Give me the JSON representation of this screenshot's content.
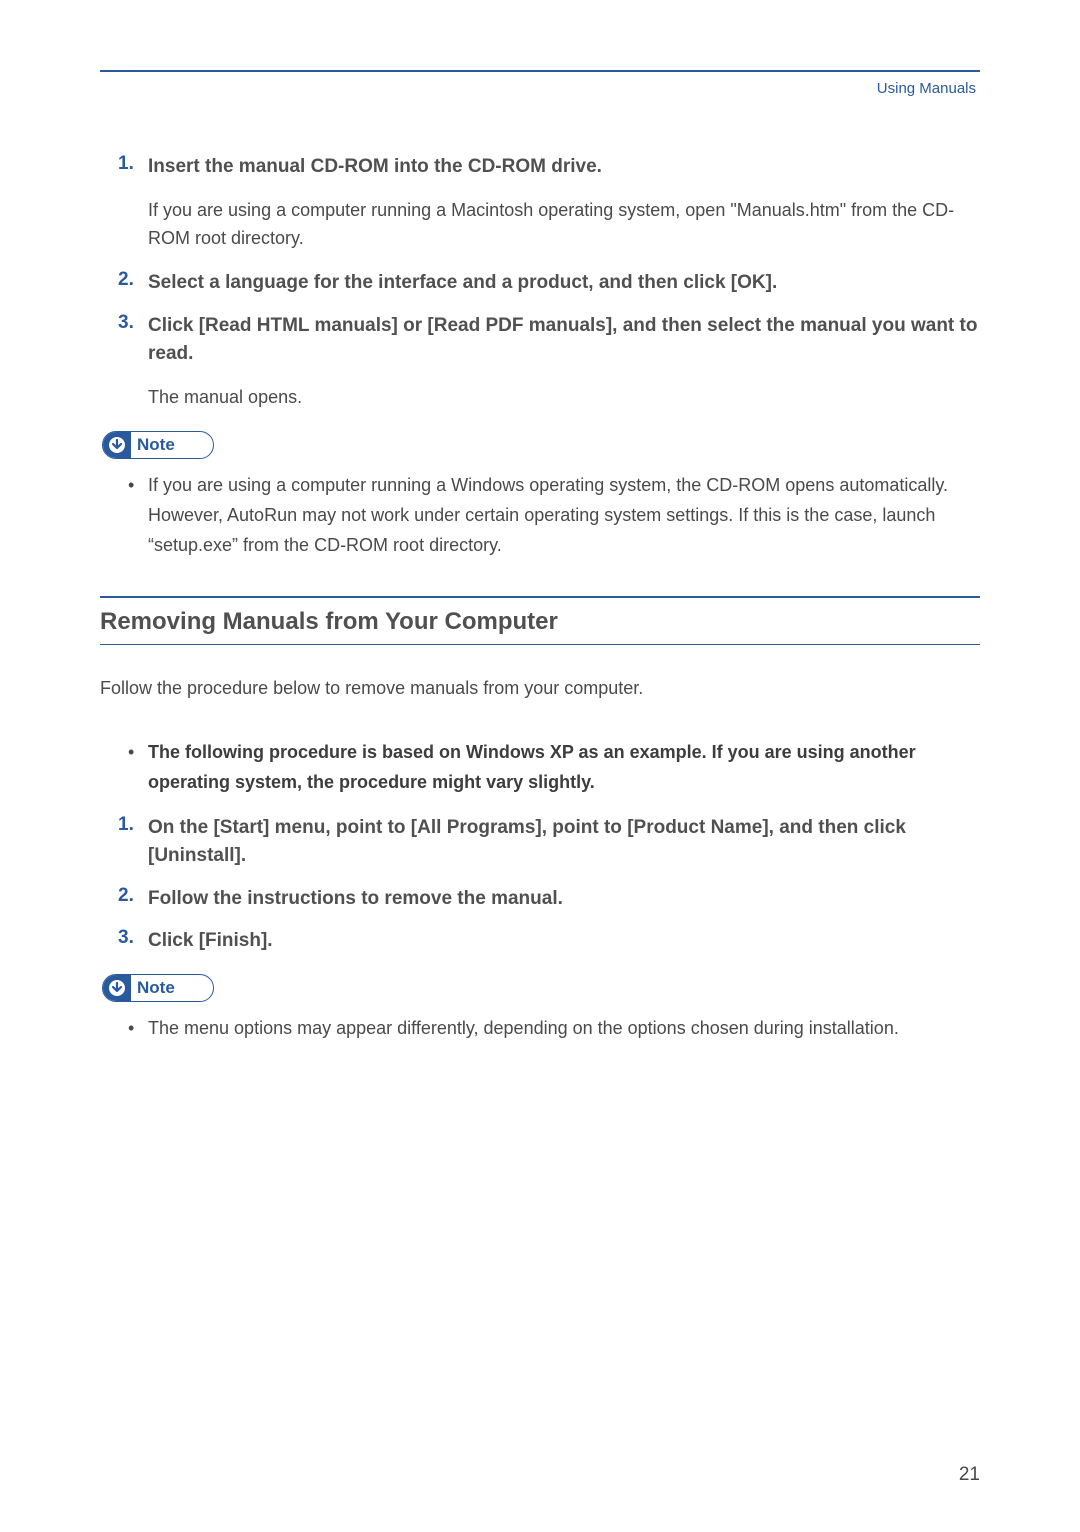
{
  "header": {
    "breadcrumb": "Using Manuals"
  },
  "steps_a": [
    {
      "num": "1.",
      "text": "Insert the manual CD-ROM into the CD-ROM drive.",
      "sub": "If you are using a computer running a Macintosh operating system, open \"Manuals.htm\" from the CD-ROM root directory."
    },
    {
      "num": "2.",
      "text": "Select a language for the interface and a product, and then click [OK]."
    },
    {
      "num": "3.",
      "text": "Click [Read HTML manuals] or [Read PDF manuals], and then select the manual you want to read.",
      "sub": "The manual opens."
    }
  ],
  "note_label": "Note",
  "note_a_bullets": [
    "If you are using a computer running a Windows operating system, the CD-ROM opens automatically. However, AutoRun may not work under certain operating system settings. If this is the case, launch “setup.exe” from the CD-ROM root directory."
  ],
  "section_heading": "Removing Manuals from Your Computer",
  "section_intro": "Follow the procedure below to remove manuals from your computer.",
  "pre_bullet": "The following procedure is based on Windows XP as an example. If you are using another operating system, the procedure might vary slightly.",
  "steps_b": [
    {
      "num": "1.",
      "text": "On the [Start] menu, point to [All Programs], point to [Product Name], and then click [Uninstall]."
    },
    {
      "num": "2.",
      "text": "Follow the instructions to remove the manual."
    },
    {
      "num": "3.",
      "text": "Click [Finish]."
    }
  ],
  "note_b_bullets": [
    "The menu options may appear differently, depending on the options chosen during installation."
  ],
  "page_number": "21"
}
